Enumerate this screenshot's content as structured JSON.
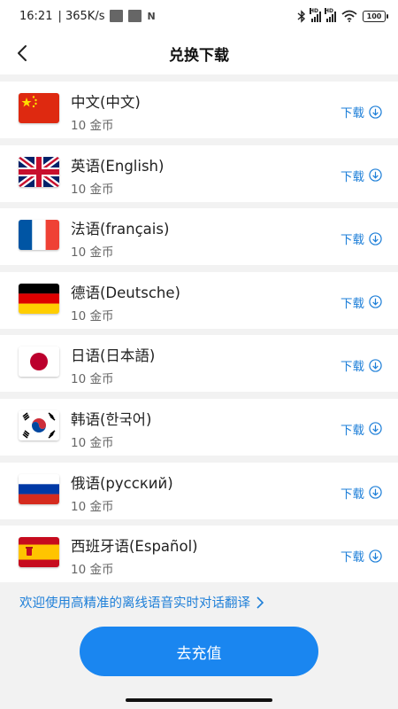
{
  "status_bar": {
    "time": "16:21",
    "speed": "| 365K/s",
    "battery": "100",
    "icons": [
      "notification-square-icon",
      "notification-square-icon",
      "nfc-icon",
      "bluetooth-icon",
      "signal-hd-icon",
      "signal-hd-icon",
      "wifi-icon",
      "battery-icon"
    ]
  },
  "header": {
    "title": "兑换下载",
    "back_icon": "chevron-left-icon"
  },
  "languages": [
    {
      "name": "中文(中文)",
      "cost": "10 金币",
      "flag": "china-flag-icon",
      "download_label": "下载"
    },
    {
      "name": "英语(English)",
      "cost": "10 金币",
      "flag": "uk-flag-icon",
      "download_label": "下载"
    },
    {
      "name": "法语(français)",
      "cost": "10 金币",
      "flag": "france-flag-icon",
      "download_label": "下载"
    },
    {
      "name": "德语(Deutsche)",
      "cost": "10 金币",
      "flag": "germany-flag-icon",
      "download_label": "下载"
    },
    {
      "name": "日语(日本語)",
      "cost": "10 金币",
      "flag": "japan-flag-icon",
      "download_label": "下载"
    },
    {
      "name": "韩语(한국어)",
      "cost": "10 金币",
      "flag": "korea-flag-icon",
      "download_label": "下载"
    },
    {
      "name": "俄语(русский)",
      "cost": "10 金币",
      "flag": "russia-flag-icon",
      "download_label": "下载"
    },
    {
      "name": "西班牙语(Español)",
      "cost": "10 金币",
      "flag": "spain-flag-icon",
      "download_label": "下载"
    }
  ],
  "promo": {
    "text": "欢迎使用高精准的离线语音实时对话翻译",
    "icon": "chevron-right-icon"
  },
  "recharge_button": {
    "label": "去充值"
  },
  "colors": {
    "accent": "#1e7fd8",
    "button": "#1a86f0",
    "background": "#f2f2f2"
  }
}
